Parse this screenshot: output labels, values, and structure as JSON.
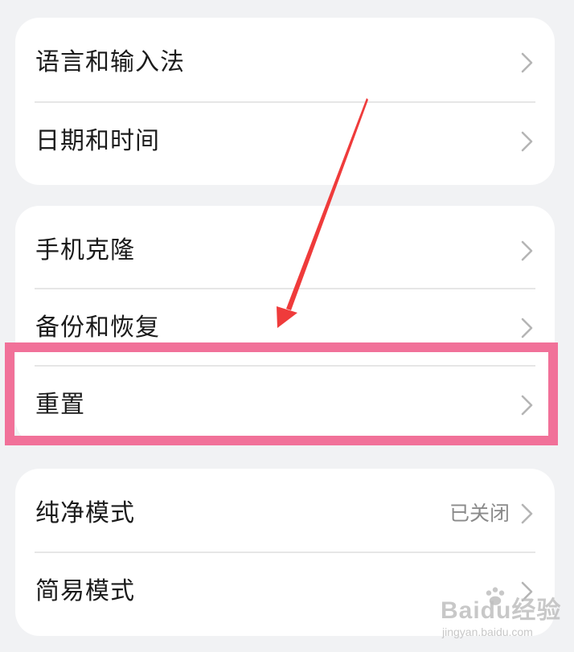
{
  "group1": {
    "items": [
      {
        "label": "语言和输入法"
      },
      {
        "label": "日期和时间"
      }
    ]
  },
  "group2": {
    "items": [
      {
        "label": "手机克隆"
      },
      {
        "label": "备份和恢复"
      },
      {
        "label": "重置"
      }
    ]
  },
  "group3": {
    "items": [
      {
        "label": "纯净模式",
        "value": "已关闭"
      },
      {
        "label": "简易模式"
      }
    ]
  },
  "annotation": {
    "highlight_color": "#f17199",
    "arrow_color": "#ef3b3b",
    "highlighted_item": "重置"
  },
  "watermark": {
    "main": "Baidu经验",
    "sub": "jingyan.baidu.com"
  },
  "icons": {
    "row_chevron": "chevron-right-icon"
  }
}
